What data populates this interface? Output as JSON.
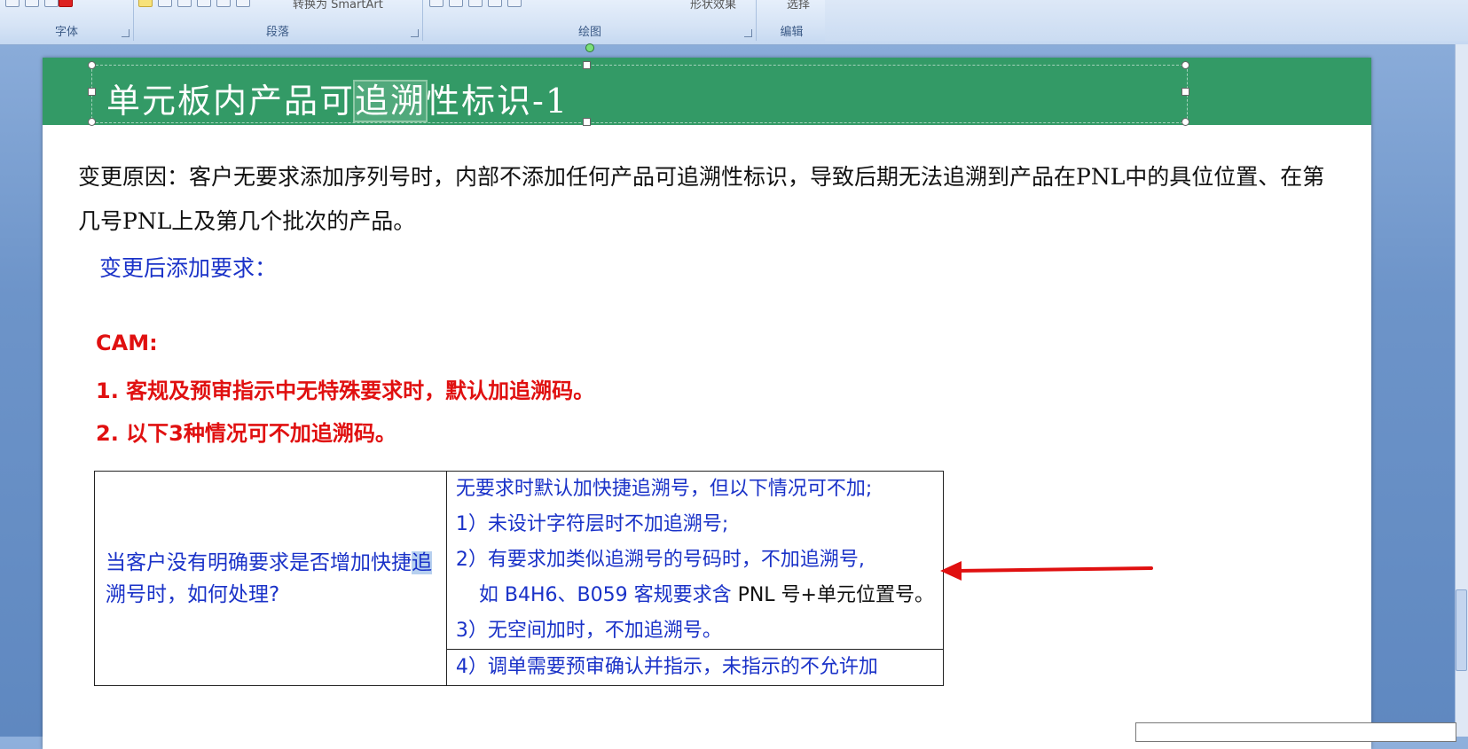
{
  "ribbon": {
    "groups": [
      {
        "label": "字体"
      },
      {
        "label": "段落"
      },
      {
        "label": "绘图"
      },
      {
        "label": "编辑"
      }
    ],
    "smartart_label": "转换为 SmartArt",
    "shape_effects_label": "形状效果",
    "select_label": "选择"
  },
  "document": {
    "title": {
      "before": "单元板内产品可",
      "highlight": "追溯",
      "after": "性标识-1"
    },
    "reason_paragraph": "变更原因：客户无要求添加序列号时，内部不添加任何产品可追溯性标识，导致后期无法追溯到产品在PNL中的具位位置、在第几号PNL上及第几个批次的产品。",
    "after_change_heading": "变更后添加要求：",
    "cam_heading": "CAM:",
    "cam_item1": "1. 客规及预审指示中无特殊要求时，默认加追溯码。",
    "cam_item2": "2. 以下3种情况可不加追溯码。",
    "table": {
      "question_before": "当客户没有明确要求是否增加快捷",
      "question_highlight": "追",
      "question_after": "溯号时，如何处理?",
      "answer_intro": "无要求时默认加快捷追溯号，但以下情况可不加;",
      "answer_1": "1）未设计字符层时不加追溯号;",
      "answer_2": "2）有要求加类似追溯号的号码时，不加追溯号,",
      "answer_2b_prefix": "如 B4H6、B059 客规要求含 ",
      "answer_2b_black": "PNL 号+单元位置号。",
      "answer_3": "3）无空间加时，不加追溯号。",
      "answer_4": "4）调单需要预审确认并指示，未指示的不允许加"
    }
  },
  "colors": {
    "title_bar": "#339a66",
    "blue_text": "#1a32c8",
    "red_text": "#e01010",
    "arrow": "#e01010"
  },
  "icons": [
    "dialog-launcher-icon",
    "arrow-annotation-icon"
  ]
}
